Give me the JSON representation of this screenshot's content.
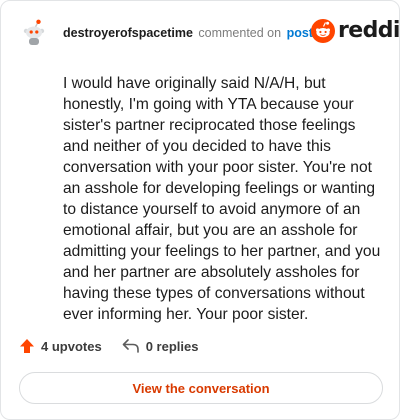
{
  "comment": {
    "author": "destroyerofspacetime",
    "action_text": "commented on",
    "post_link": "post",
    "body": "I would have originally said N/A/H, but honestly, I'm going with YTA because your sister's partner reciprocated those feelings and neither of you decided to have this conversation with your poor sister. You're not an asshole for developing feelings or wanting to distance yourself to avoid anymore of an emotional affair, but you are an asshole for admitting your feelings to her partner, and you and her partner are absolutely assholes for having these types of conversations without ever informing her. Your poor sister.",
    "upvotes_label": "4 upvotes",
    "replies_label": "0 replies"
  },
  "brand": {
    "name": "reddit",
    "color": "#ff4500"
  },
  "cta": {
    "label": "View the conversation"
  },
  "colors": {
    "link": "#0079d3",
    "upvote": "#ff4500",
    "cta_text": "#d93a00",
    "text": "#1c1c1c",
    "muted": "#7c7c7c"
  },
  "icons": {
    "avatar": "snoo-avatar-icon",
    "logo": "reddit-logo-icon",
    "upvote": "upvote-arrow-icon",
    "reply": "reply-arrow-icon"
  }
}
